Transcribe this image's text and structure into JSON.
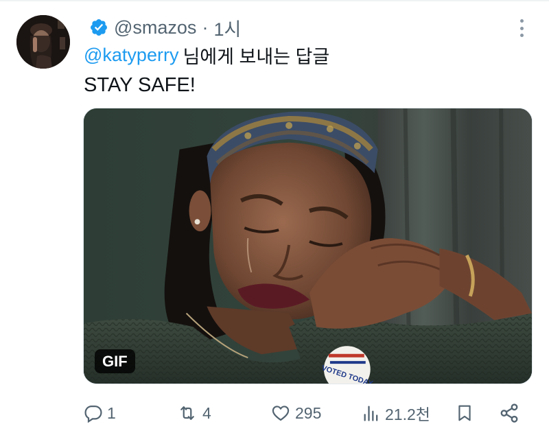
{
  "user": {
    "handle": "@smazos",
    "separator": "·",
    "time": "1시",
    "verified": true
  },
  "reply": {
    "mention": "@katyperry",
    "suffix": "님에게 보내는 답글"
  },
  "tweet": {
    "text": "STAY SAFE!"
  },
  "media": {
    "badge": "GIF",
    "button_text": "VOTED TODAY"
  },
  "actions": {
    "replies": "1",
    "reposts": "4",
    "likes": "295",
    "views": "21.2천"
  },
  "colors": {
    "accent": "#1d9bf0",
    "secondary_text": "#536471",
    "primary_text": "#0f1419"
  }
}
